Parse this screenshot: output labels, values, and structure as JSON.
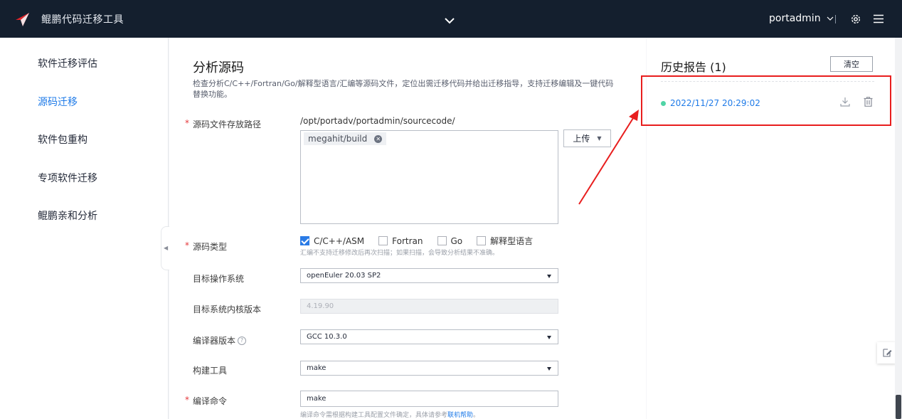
{
  "header": {
    "app_title": "鲲鹏代码迁移工具",
    "user": "portadmin"
  },
  "sidebar": {
    "items": [
      {
        "label": "软件迁移评估"
      },
      {
        "label": "源码迁移"
      },
      {
        "label": "软件包重构"
      },
      {
        "label": "专项软件迁移"
      },
      {
        "label": "鲲鹏亲和分析"
      }
    ],
    "active_index": 1
  },
  "main": {
    "title": "分析源码",
    "description": "检查分析C/C++/Fortran/Go/解释型语言/汇编等源码文件，定位出需迁移代码并给出迁移指导，支持迁移编辑及一键代码替换功能。",
    "source_path": {
      "label": "源码文件存放路径",
      "path": "/opt/portadv/portadmin/sourcecode/",
      "tag": "megahit/build",
      "upload_label": "上传"
    },
    "source_type": {
      "label": "源码类型",
      "options": [
        {
          "label": "C/C++/ASM",
          "checked": true
        },
        {
          "label": "Fortran",
          "checked": false
        },
        {
          "label": "Go",
          "checked": false
        },
        {
          "label": "解释型语言",
          "checked": false
        }
      ],
      "hint": "汇编不支持迁移修改后再次扫描；如果扫描，会导致分析结果不准确。"
    },
    "target_os": {
      "label": "目标操作系统",
      "value": "openEuler 20.03 SP2"
    },
    "kernel": {
      "label": "目标系统内核版本",
      "value": "4.19.90"
    },
    "compiler": {
      "label": "编译器版本",
      "value": "GCC 10.3.0",
      "help": "?"
    },
    "build_tool": {
      "label": "构建工具",
      "value": "make"
    },
    "build_cmd": {
      "label": "编译命令",
      "value": "make",
      "hint": "编译命令需根据构建工具配置文件确定，具体请参考",
      "hint_link": "联机帮助",
      "hint_end": "。"
    }
  },
  "history": {
    "title": "历史报告 (1)",
    "clear_label": "清空",
    "reports": [
      {
        "timestamp": "2022/11/27 20:29:02",
        "status_color": "#50d4a6"
      }
    ]
  },
  "colors": {
    "topbar": "#141f2e",
    "accent": "#1f7be8",
    "annotation": "#e81e1e"
  }
}
